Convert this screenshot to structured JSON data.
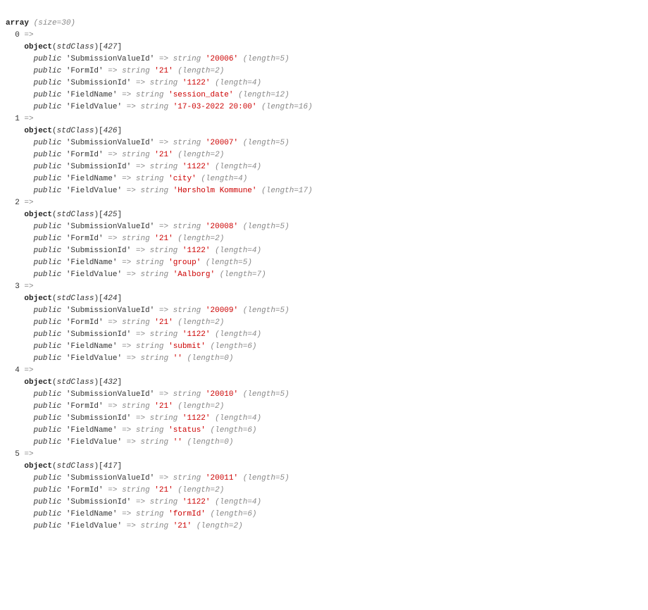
{
  "header": {
    "kw_array": "array",
    "size_label": "(size=",
    "size": "30",
    "close": ")"
  },
  "kw_object": "object",
  "class_name": "stdClass",
  "kw_public": "public",
  "arrow": "=>",
  "type_string": "string",
  "length_prefix": "(length=",
  "length_suffix": ")",
  "entries": [
    {
      "index": "0",
      "id": "427",
      "props": [
        {
          "name": "SubmissionValueId",
          "value": "20006",
          "len": "5"
        },
        {
          "name": "FormId",
          "value": "21",
          "len": "2"
        },
        {
          "name": "SubmissionId",
          "value": "1122",
          "len": "4"
        },
        {
          "name": "FieldName",
          "value": "session_date",
          "len": "12"
        },
        {
          "name": "FieldValue",
          "value": "17-03-2022 20:00",
          "len": "16"
        }
      ]
    },
    {
      "index": "1",
      "id": "426",
      "props": [
        {
          "name": "SubmissionValueId",
          "value": "20007",
          "len": "5"
        },
        {
          "name": "FormId",
          "value": "21",
          "len": "2"
        },
        {
          "name": "SubmissionId",
          "value": "1122",
          "len": "4"
        },
        {
          "name": "FieldName",
          "value": "city",
          "len": "4"
        },
        {
          "name": "FieldValue",
          "value": "Hørsholm Kommune",
          "len": "17"
        }
      ]
    },
    {
      "index": "2",
      "id": "425",
      "props": [
        {
          "name": "SubmissionValueId",
          "value": "20008",
          "len": "5"
        },
        {
          "name": "FormId",
          "value": "21",
          "len": "2"
        },
        {
          "name": "SubmissionId",
          "value": "1122",
          "len": "4"
        },
        {
          "name": "FieldName",
          "value": "group",
          "len": "5"
        },
        {
          "name": "FieldValue",
          "value": "Aalborg",
          "len": "7"
        }
      ]
    },
    {
      "index": "3",
      "id": "424",
      "props": [
        {
          "name": "SubmissionValueId",
          "value": "20009",
          "len": "5"
        },
        {
          "name": "FormId",
          "value": "21",
          "len": "2"
        },
        {
          "name": "SubmissionId",
          "value": "1122",
          "len": "4"
        },
        {
          "name": "FieldName",
          "value": "submit",
          "len": "6"
        },
        {
          "name": "FieldValue",
          "value": "",
          "len": "0"
        }
      ]
    },
    {
      "index": "4",
      "id": "432",
      "props": [
        {
          "name": "SubmissionValueId",
          "value": "20010",
          "len": "5"
        },
        {
          "name": "FormId",
          "value": "21",
          "len": "2"
        },
        {
          "name": "SubmissionId",
          "value": "1122",
          "len": "4"
        },
        {
          "name": "FieldName",
          "value": "status",
          "len": "6"
        },
        {
          "name": "FieldValue",
          "value": "",
          "len": "0"
        }
      ]
    },
    {
      "index": "5",
      "id": "417",
      "props": [
        {
          "name": "SubmissionValueId",
          "value": "20011",
          "len": "5"
        },
        {
          "name": "FormId",
          "value": "21",
          "len": "2"
        },
        {
          "name": "SubmissionId",
          "value": "1122",
          "len": "4"
        },
        {
          "name": "FieldName",
          "value": "formId",
          "len": "6"
        },
        {
          "name": "FieldValue",
          "value": "21",
          "len": "2"
        }
      ]
    }
  ]
}
